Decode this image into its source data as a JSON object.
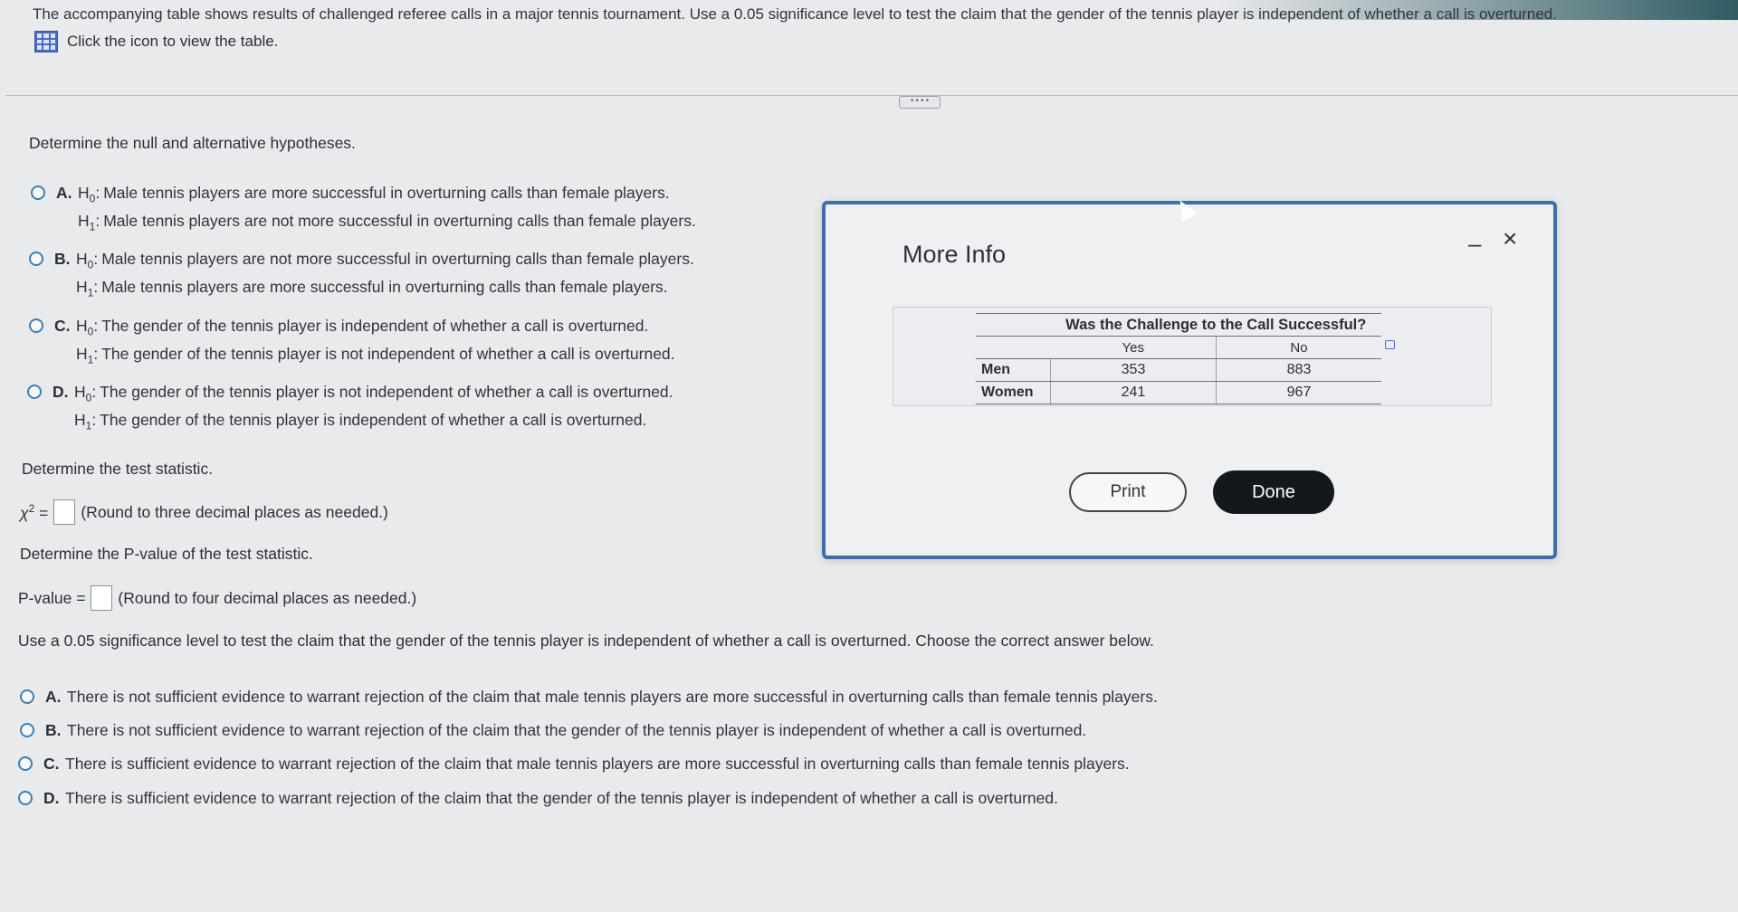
{
  "header": {
    "prompt": "The accompanying table shows results of challenged referee calls in a major tennis tournament. Use a 0.05 significance level to test the claim that the gender of the tennis player is independent of whether a call is overturned.",
    "view_table_link": "Click the icon to view the table."
  },
  "part1": {
    "question": "Determine the null and alternative hypotheses.",
    "options": [
      {
        "letter": "A.",
        "h0": "Male tennis players are more successful in overturning calls than female players.",
        "h1": "Male tennis players are not more successful in overturning calls than female players."
      },
      {
        "letter": "B.",
        "h0": "Male tennis players are not more successful in overturning calls than female players.",
        "h1": "Male tennis players are more successful in overturning calls than female players."
      },
      {
        "letter": "C.",
        "h0": "The gender of the tennis player is independent of whether a call is overturned.",
        "h1": "The gender of the tennis player is not independent of whether a call is overturned."
      },
      {
        "letter": "D.",
        "h0": "The gender of the tennis player is not independent of whether a call is overturned.",
        "h1": "The gender of the tennis player is independent of whether a call is overturned."
      }
    ],
    "h0_label": "H",
    "h0_sub": "0",
    "h1_label": "H",
    "h1_sub": "1",
    "colon": ":"
  },
  "part2": {
    "question": "Determine the test statistic.",
    "chi_label": "χ",
    "chi_sup": "2",
    "equals": "=",
    "hint": "(Round to three decimal places as needed.)"
  },
  "part3": {
    "question": "Determine the P-value of the test statistic.",
    "label": "P-value =",
    "hint": "(Round to four decimal places as needed.)"
  },
  "part4": {
    "question": "Use a 0.05 significance level to test the claim that the gender of the tennis player is independent of whether a call is overturned. Choose the correct answer below.",
    "options": [
      {
        "letter": "A.",
        "text": "There is not sufficient evidence to warrant rejection of the claim that male tennis players are more successful in overturning calls than female tennis players."
      },
      {
        "letter": "B.",
        "text": "There is not sufficient evidence to warrant rejection of the claim that the gender of the tennis player is independent of whether a call is overturned."
      },
      {
        "letter": "C.",
        "text": "There is sufficient evidence to warrant rejection of the claim that male tennis players are more successful in overturning calls than female tennis players."
      },
      {
        "letter": "D.",
        "text": "There is sufficient evidence to warrant rejection of the claim that the gender of the tennis player is independent of whether a call is overturned."
      }
    ]
  },
  "dialog": {
    "title": "More Info",
    "minimize": "–",
    "close": "×",
    "table": {
      "header": "Was the Challenge to the Call Successful?",
      "columns": [
        "Yes",
        "No"
      ],
      "rows": [
        {
          "label": "Men",
          "values": [
            "353",
            "883"
          ]
        },
        {
          "label": "Women",
          "values": [
            "241",
            "967"
          ]
        }
      ]
    },
    "print_label": "Print",
    "done_label": "Done"
  },
  "expander_label": "• • • •"
}
